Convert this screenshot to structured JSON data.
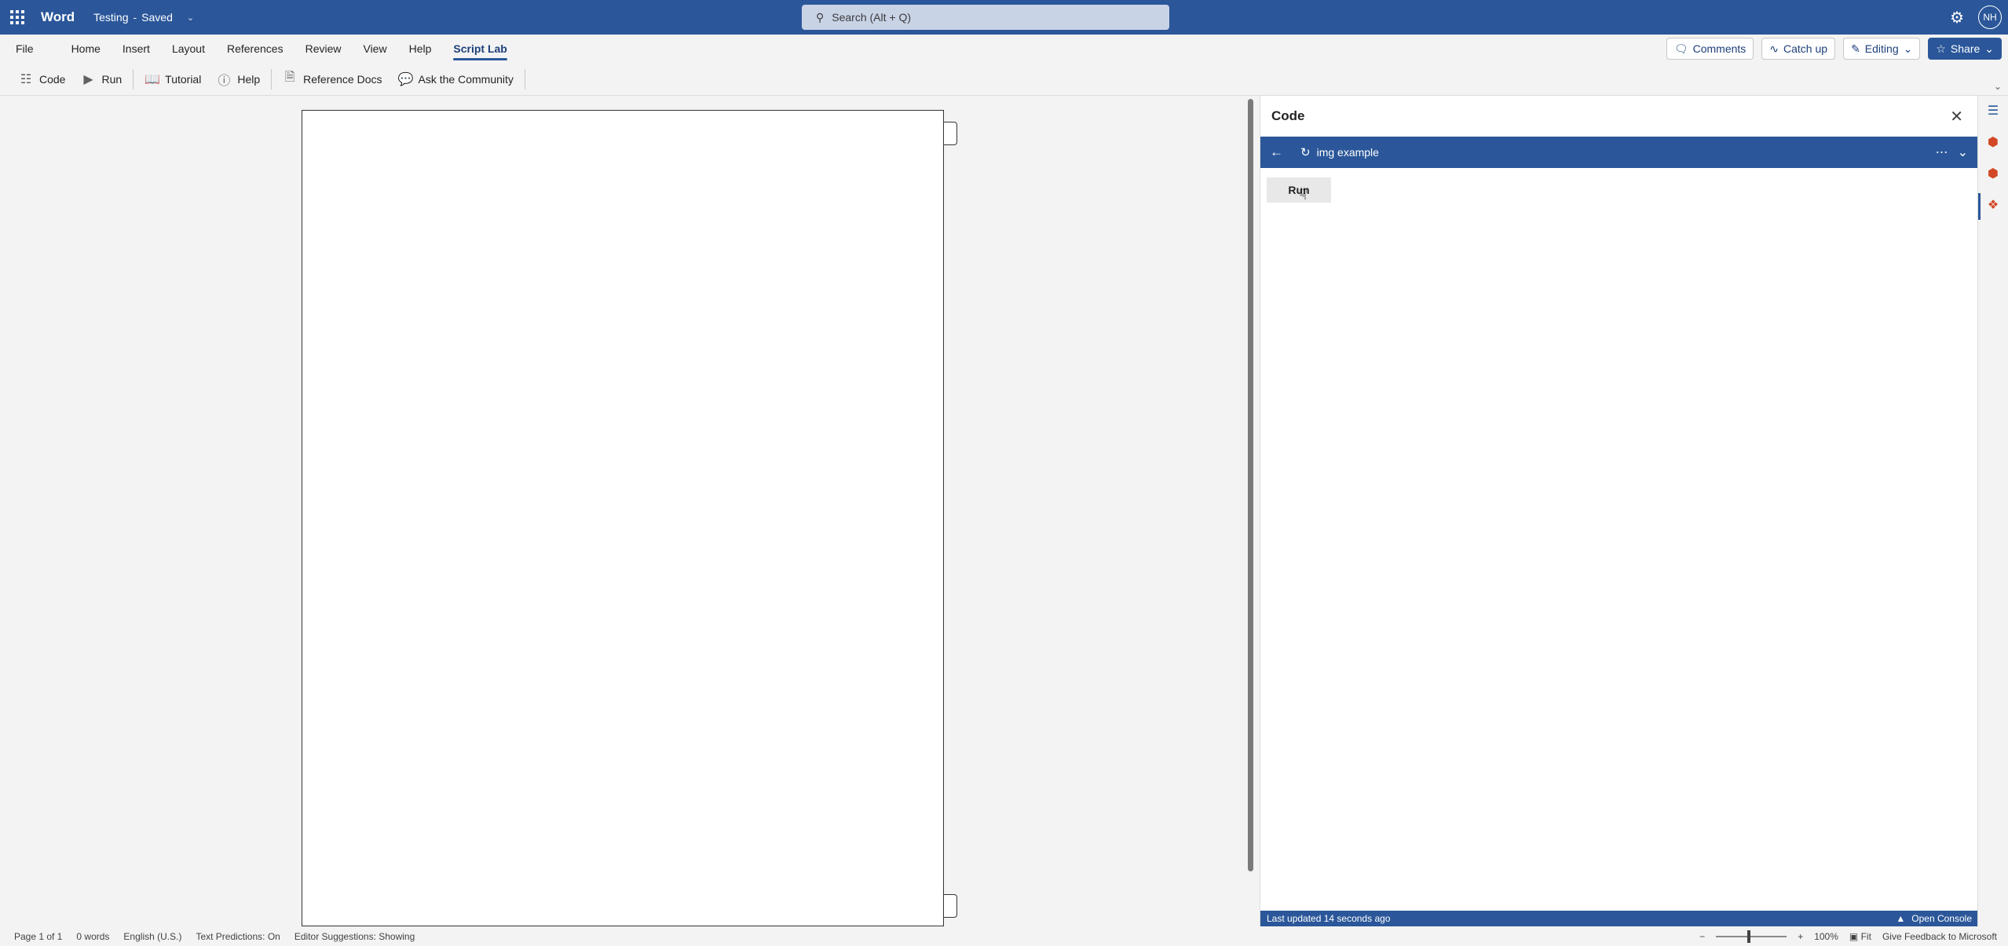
{
  "titlebar": {
    "app_name": "Word",
    "doc_name": "Testing",
    "separator": "-",
    "save_state": "Saved",
    "search_placeholder": "Search (Alt + Q)",
    "user_initials": "NH"
  },
  "menu": {
    "tabs": [
      "File",
      "Home",
      "Insert",
      "Layout",
      "References",
      "Review",
      "View",
      "Help",
      "Script Lab"
    ],
    "active_tab": "Script Lab",
    "comments_label": "Comments",
    "catchup_label": "Catch up",
    "editing_label": "Editing",
    "share_label": "Share"
  },
  "ribbon": {
    "code_label": "Code",
    "run_label": "Run",
    "tutorial_label": "Tutorial",
    "help_label": "Help",
    "reference_docs_label": "Reference Docs",
    "ask_community_label": "Ask the Community"
  },
  "pane": {
    "title": "Code",
    "snippet_name": "img example",
    "run_button_label": "Run",
    "last_updated": "Last updated 14 seconds ago",
    "open_console_label": "Open Console"
  },
  "status": {
    "page": "Page 1 of 1",
    "words": "0 words",
    "language": "English (U.S.)",
    "text_predictions": "Text Predictions: On",
    "editor_suggestions": "Editor Suggestions: Showing",
    "zoom": "100%",
    "fit_label": "Fit",
    "feedback_label": "Give Feedback to Microsoft"
  },
  "colors": {
    "brand": "#2b579a",
    "toolbar_bg": "#f3f3f3",
    "addin_orange": "#d24726"
  }
}
